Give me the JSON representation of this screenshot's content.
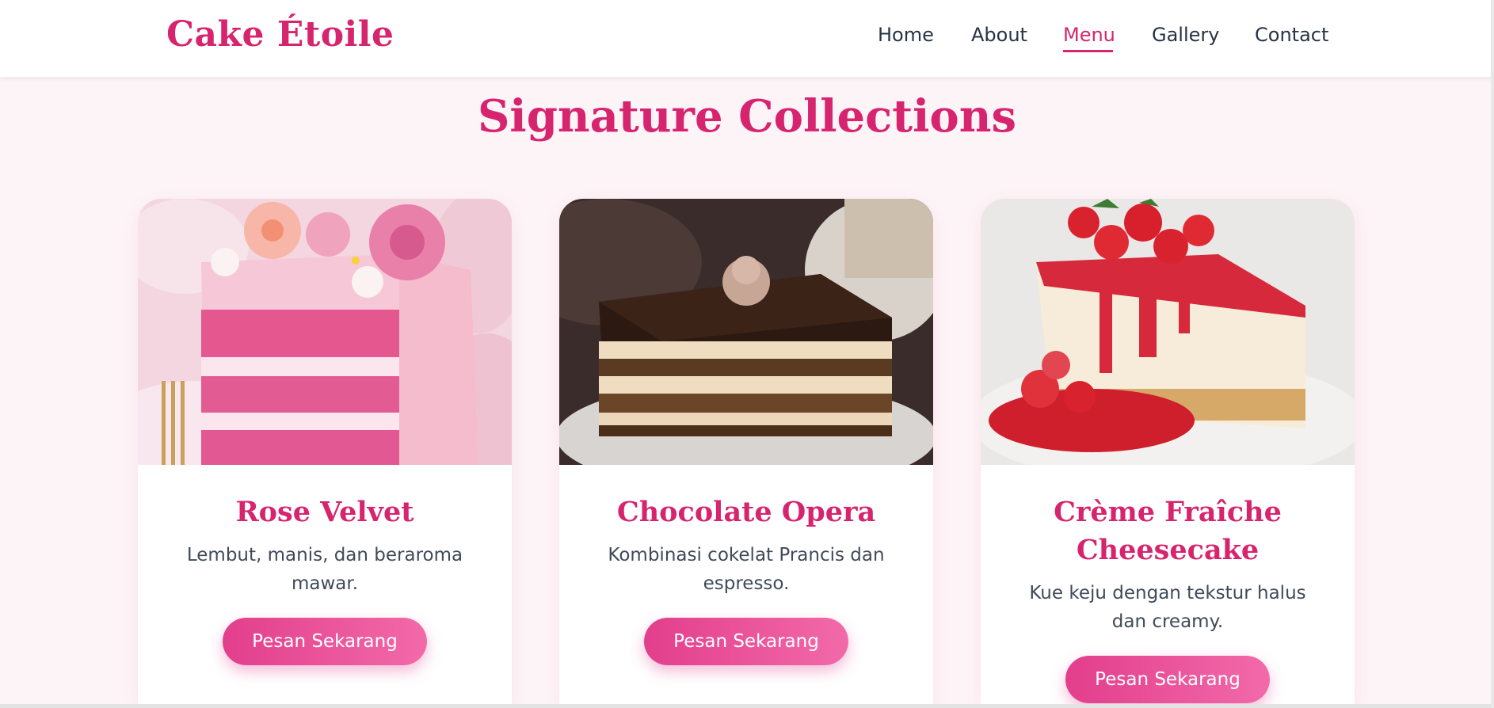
{
  "brand": "Cake Étoile",
  "nav": {
    "home": "Home",
    "about": "About",
    "menu": "Menu",
    "gallery": "Gallery",
    "contact": "Contact",
    "active": "Menu"
  },
  "section": {
    "title": "Signature Collections"
  },
  "cards": [
    {
      "title": "Rose Velvet",
      "description": "Lembut, manis, dan beraroma mawar.",
      "button": "Pesan Sekarang"
    },
    {
      "title": "Chocolate Opera",
      "description": "Kombinasi cokelat Prancis dan espresso.",
      "button": "Pesan Sekarang"
    },
    {
      "title": "Crème Fraîche Cheesecake",
      "description": "Kue keju dengan tekstur halus dan creamy.",
      "button": "Pesan Sekarang"
    }
  ],
  "colors": {
    "accent": "#d6246e",
    "button_start": "#e23e8c",
    "button_end": "#f26aa9",
    "background": "#fdf4f7",
    "nav_text": "#263445"
  }
}
